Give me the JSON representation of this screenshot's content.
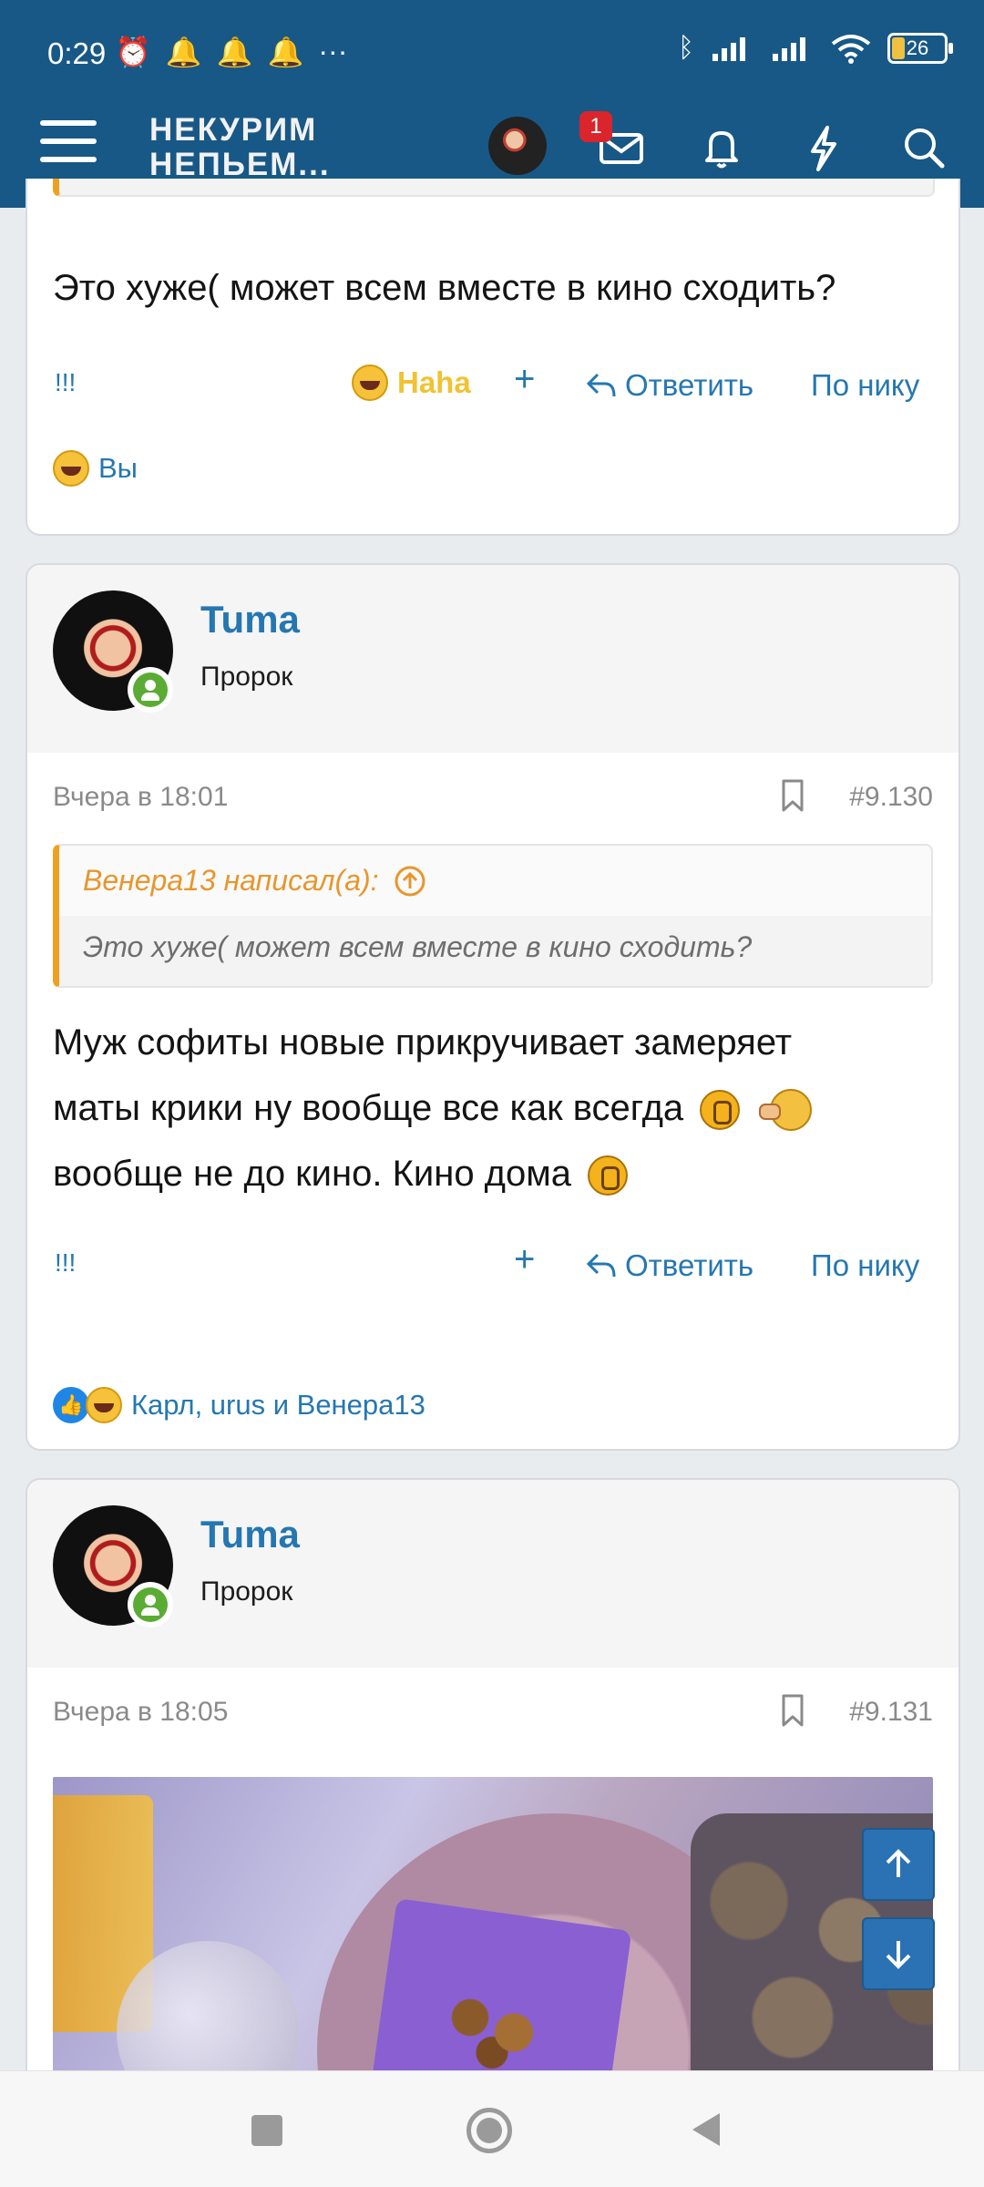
{
  "status": {
    "time": "0:29",
    "battery": "26"
  },
  "header": {
    "logo_line1": "НЕКУРИМ",
    "logo_line2": "НЕПЬЕМ...",
    "inbox_badge": "1"
  },
  "post1": {
    "text": "Это хуже( может всем вместе в кино сходить?",
    "mark": "!!!",
    "reaction_label": "Haha",
    "plus": "+",
    "reply": "Ответить",
    "by_nick": "По нику",
    "reactions_by": "Вы"
  },
  "post2": {
    "username": "Tuma",
    "user_title": "Пророк",
    "date": "Вчера в 18:01",
    "number": "#9.130",
    "quote_author": "Венера13 написал(а):",
    "quote_text": "Это хуже( может всем вместе в кино сходить?",
    "line1": "Муж софиты новые прикручивает замеряет",
    "line2": "маты крики ну вообще все как всегда",
    "line3": "вообще не до кино. Кино дома",
    "mark": "!!!",
    "plus": "+",
    "reply": "Ответить",
    "by_nick": "По нику",
    "reactions_by": "Карл, urus и Венера13"
  },
  "post3": {
    "username": "Tuma",
    "user_title": "Пророк",
    "date": "Вчера в 18:05",
    "number": "#9.131"
  }
}
